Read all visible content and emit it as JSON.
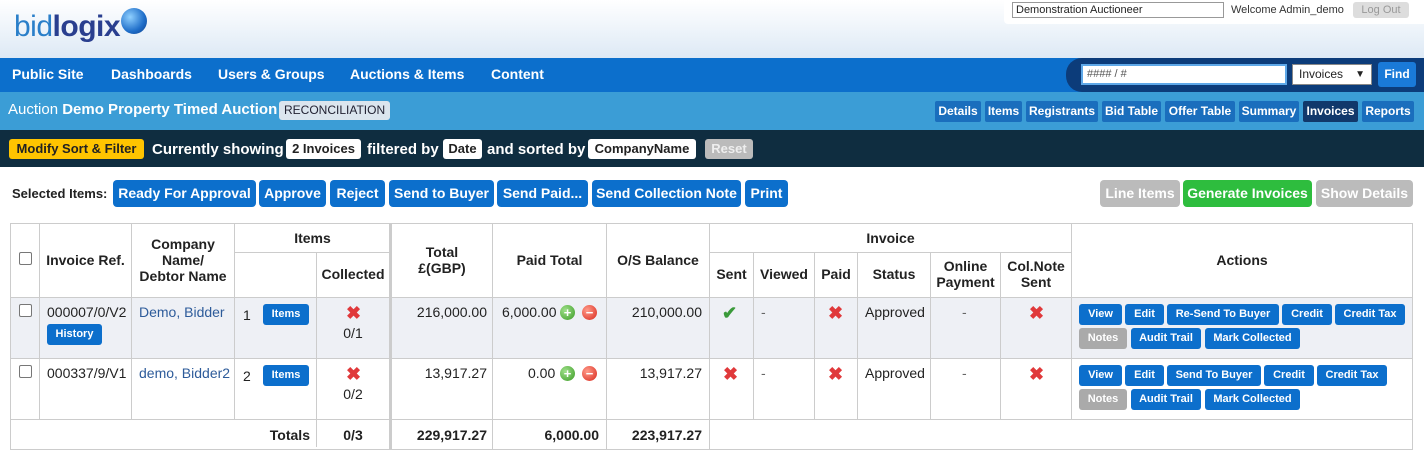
{
  "header": {
    "logo_text_light": "bid",
    "logo_text_bold": "logix",
    "auctioneer_field": "Demonstration Auctioneer",
    "welcome": "Welcome Admin_demo",
    "logout": "Log Out"
  },
  "nav": {
    "items": [
      "Public Site",
      "Dashboards",
      "Users & Groups",
      "Auctions & Items",
      "Content"
    ]
  },
  "search": {
    "value": "#### / #",
    "type_selected": "Invoices",
    "find_label": "Find"
  },
  "auction": {
    "prefix": "Auction",
    "name": "Demo Property Timed Auction",
    "status": "RECONCILIATION",
    "tabs": [
      {
        "label": "Details",
        "active": false
      },
      {
        "label": "Items",
        "active": false
      },
      {
        "label": "Registrants",
        "active": false
      },
      {
        "label": "Bid Table",
        "active": false
      },
      {
        "label": "Offer Table",
        "active": false
      },
      {
        "label": "Summary",
        "active": false
      },
      {
        "label": "Invoices",
        "active": true
      },
      {
        "label": "Reports",
        "active": false
      }
    ]
  },
  "filter": {
    "modify_label": "Modify Sort & Filter",
    "showing_text": "Currently showing",
    "count_label": "2 Invoices",
    "filtered_text": "filtered by",
    "filter_field": "Date",
    "sorted_text": "and sorted by",
    "sort_field": "CompanyName",
    "reset_label": "Reset"
  },
  "actions": {
    "selected_label": "Selected Items:",
    "buttons": [
      "Ready For Approval",
      "Approve",
      "Reject",
      "Send to Buyer",
      "Send Paid...",
      "Send Collection Note",
      "Print"
    ],
    "line_items": "Line Items",
    "generate_invoices": "Generate Invoices",
    "show_details": "Show Details"
  },
  "table": {
    "headers": {
      "invoice_ref": "Invoice Ref.",
      "company_l1": "Company",
      "company_l2": "Name/",
      "company_l3": "Debtor Name",
      "items": "Items",
      "collected": "Collected",
      "total_l1": "Total",
      "total_l2": "£(GBP)",
      "paid_total": "Paid Total",
      "os_balance": "O/S Balance",
      "invoice": "Invoice",
      "sent": "Sent",
      "viewed": "Viewed",
      "paid": "Paid",
      "status": "Status",
      "online_l1": "Online",
      "online_l2": "Payment",
      "colnote_l1": "Col.Note",
      "colnote_l2": "Sent",
      "actions": "Actions"
    },
    "rows": [
      {
        "ref": "000007/0/V2",
        "history": "History",
        "company": "Demo, Bidder",
        "item_count": "1",
        "items_btn": "Items",
        "collected": "0/1",
        "total": "216,000.00",
        "paid_total": "6,000.00",
        "os_balance": "210,000.00",
        "sent": "check",
        "viewed": "-",
        "paid": "cross",
        "status": "Approved",
        "online_payment": "-",
        "colnote_sent": "cross",
        "actions_row1": [
          "View",
          "Edit",
          "Re-Send To Buyer",
          "Credit",
          "Credit Tax"
        ],
        "actions_row2": [
          "Notes",
          "Audit Trail",
          "Mark Collected"
        ]
      },
      {
        "ref": "000337/9/V1",
        "company": "demo, Bidder2",
        "item_count": "2",
        "items_btn": "Items",
        "collected": "0/2",
        "total": "13,917.27",
        "paid_total": "0.00",
        "os_balance": "13,917.27",
        "sent": "cross",
        "viewed": "-",
        "paid": "cross",
        "status": "Approved",
        "online_payment": "-",
        "colnote_sent": "cross",
        "actions_row1": [
          "View",
          "Edit",
          "Send To Buyer",
          "Credit",
          "Credit Tax"
        ],
        "actions_row2": [
          "Notes",
          "Audit Trail",
          "Mark Collected"
        ]
      }
    ],
    "totals": {
      "label": "Totals",
      "collected": "0/3",
      "total": "229,917.27",
      "paid_total": "6,000.00",
      "os_balance": "223,917.27"
    }
  }
}
